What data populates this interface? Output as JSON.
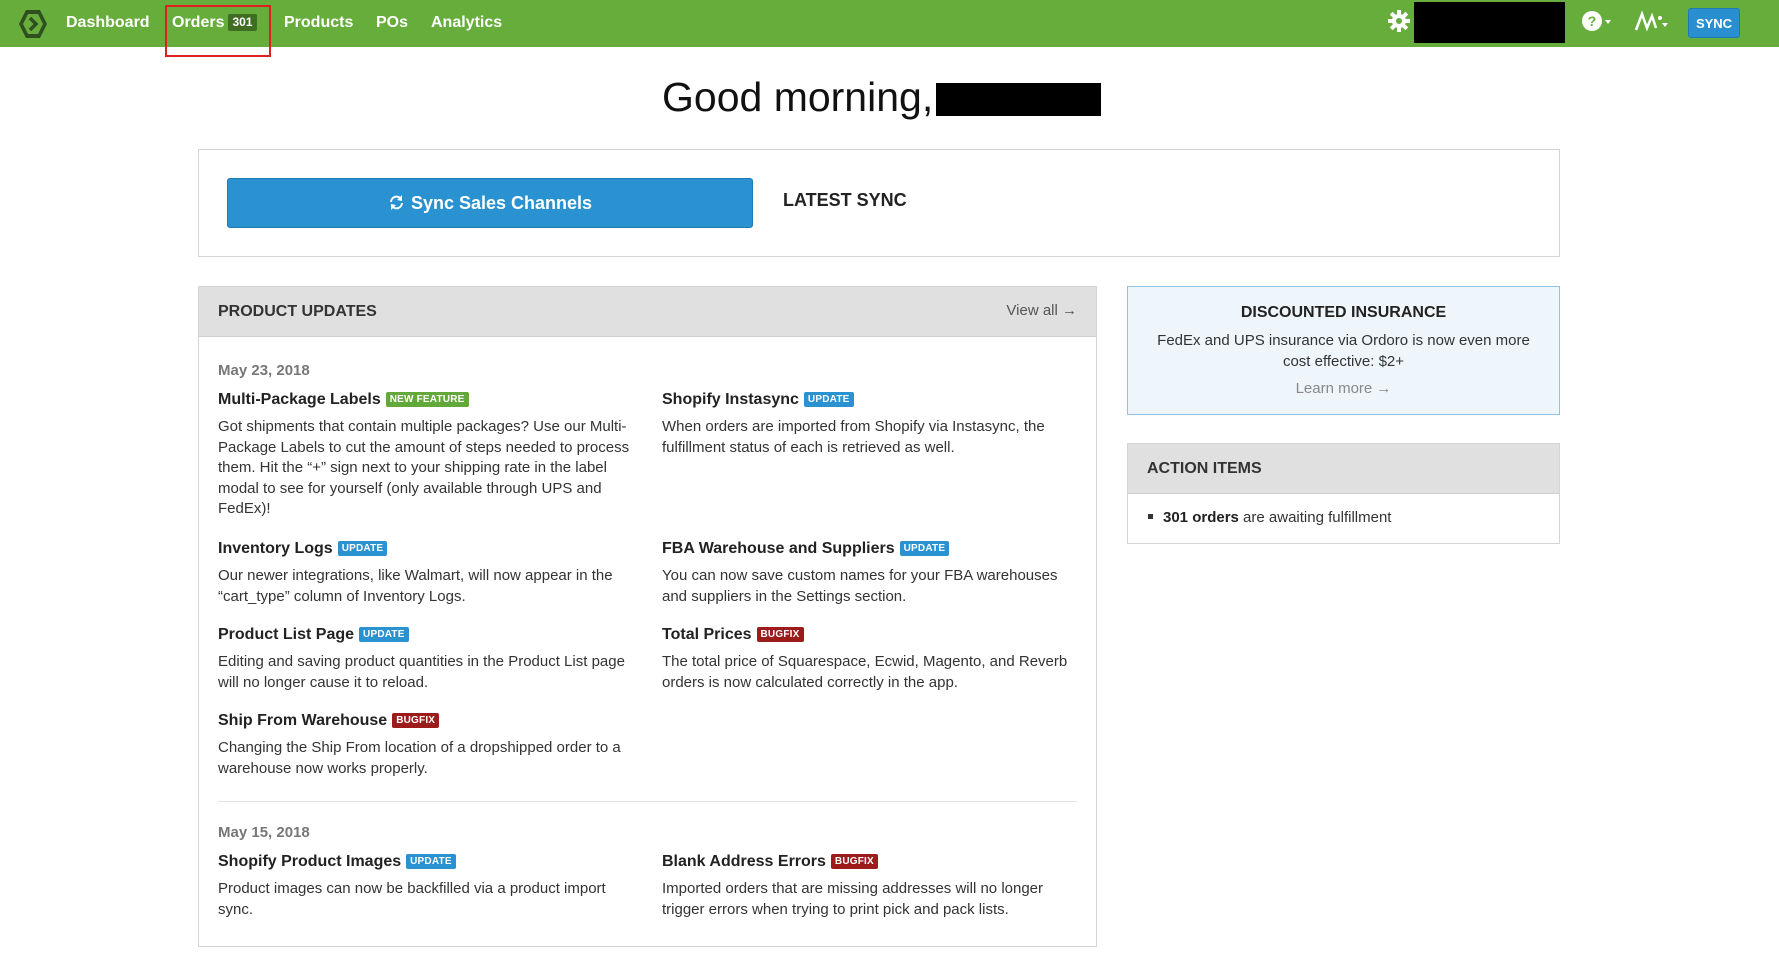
{
  "nav": {
    "logo": "ordoro-logo-icon",
    "items": [
      {
        "label": "Dashboard"
      },
      {
        "label": "Orders",
        "count": "301"
      },
      {
        "label": "Products"
      },
      {
        "label": "POs"
      },
      {
        "label": "Analytics"
      }
    ],
    "icons": [
      "gear-icon",
      "help-icon",
      "activity-icon"
    ],
    "sync_label": "SYNC"
  },
  "greeting": "Good morning,",
  "sync_panel": {
    "button_label": "Sync Sales Channels",
    "latest_sync_label": "LATEST SYNC"
  },
  "product_updates": {
    "title": "PRODUCT UPDATES",
    "view_all": "View all →",
    "groups": [
      {
        "date": "May 23, 2018",
        "entries": [
          {
            "title": "Multi-Package Labels",
            "tag": "NEW FEATURE",
            "tag_color": "#62a83a",
            "body": "Got shipments that contain multiple packages? Use our Multi-Package Labels to cut the amount of steps needed to process them. Hit the “+” sign next to your shipping rate in the label modal to see for yourself (only available through UPS and FedEx)!"
          },
          {
            "title": "Shopify Instasync",
            "tag": "UPDATE",
            "tag_color": "#2a92d0",
            "body": "When orders are imported from Shopify via Instasync, the fulfillment status of each is retrieved as well."
          },
          {
            "title": "Inventory Logs",
            "tag": "UPDATE",
            "tag_color": "#2a92d0",
            "body": "Our newer integrations, like Walmart, will now appear in the “cart_type” column of Inventory Logs."
          },
          {
            "title": "FBA Warehouse and Suppliers",
            "tag": "UPDATE",
            "tag_color": "#2a92d0",
            "body": "You can now save custom names for your FBA warehouses and suppliers in the Settings section."
          },
          {
            "title": "Product List Page",
            "tag": "UPDATE",
            "tag_color": "#2a92d0",
            "body": "Editing and saving product quantities in the Product List page will no longer cause it to reload."
          },
          {
            "title": "Total Prices",
            "tag": "BUGFIX",
            "tag_color": "#9c1c1c",
            "body": "The total price of Squarespace, Ecwid, Magento, and Reverb orders is now calculated correctly in the app."
          },
          {
            "title": "Ship From Warehouse",
            "tag": "BUGFIX",
            "tag_color": "#9c1c1c",
            "body": "Changing the Ship From location of a dropshipped order to a warehouse now works properly."
          }
        ]
      },
      {
        "date": "May 15, 2018",
        "entries": [
          {
            "title": "Shopify Product Images",
            "tag": "UPDATE",
            "tag_color": "#2a92d0",
            "body": "Product images can now be backfilled via a product import sync."
          },
          {
            "title": "Blank Address Errors",
            "tag": "BUGFIX",
            "tag_color": "#9c1c1c",
            "body": "Imported orders that are missing addresses will no longer trigger errors when trying to print pick and pack lists."
          }
        ]
      }
    ]
  },
  "insurance": {
    "title": "DISCOUNTED INSURANCE",
    "body": "FedEx and UPS insurance via Ordoro is now even more cost effective: $2+",
    "link": "Learn more →"
  },
  "action_items": {
    "title": "ACTION ITEMS",
    "item_strong": "301 orders",
    "item_rest": " are awaiting fulfillment"
  },
  "colors": {
    "topbar": "#67ad3b",
    "primary_button": "#2a92d0",
    "highlight": "#e02020"
  }
}
